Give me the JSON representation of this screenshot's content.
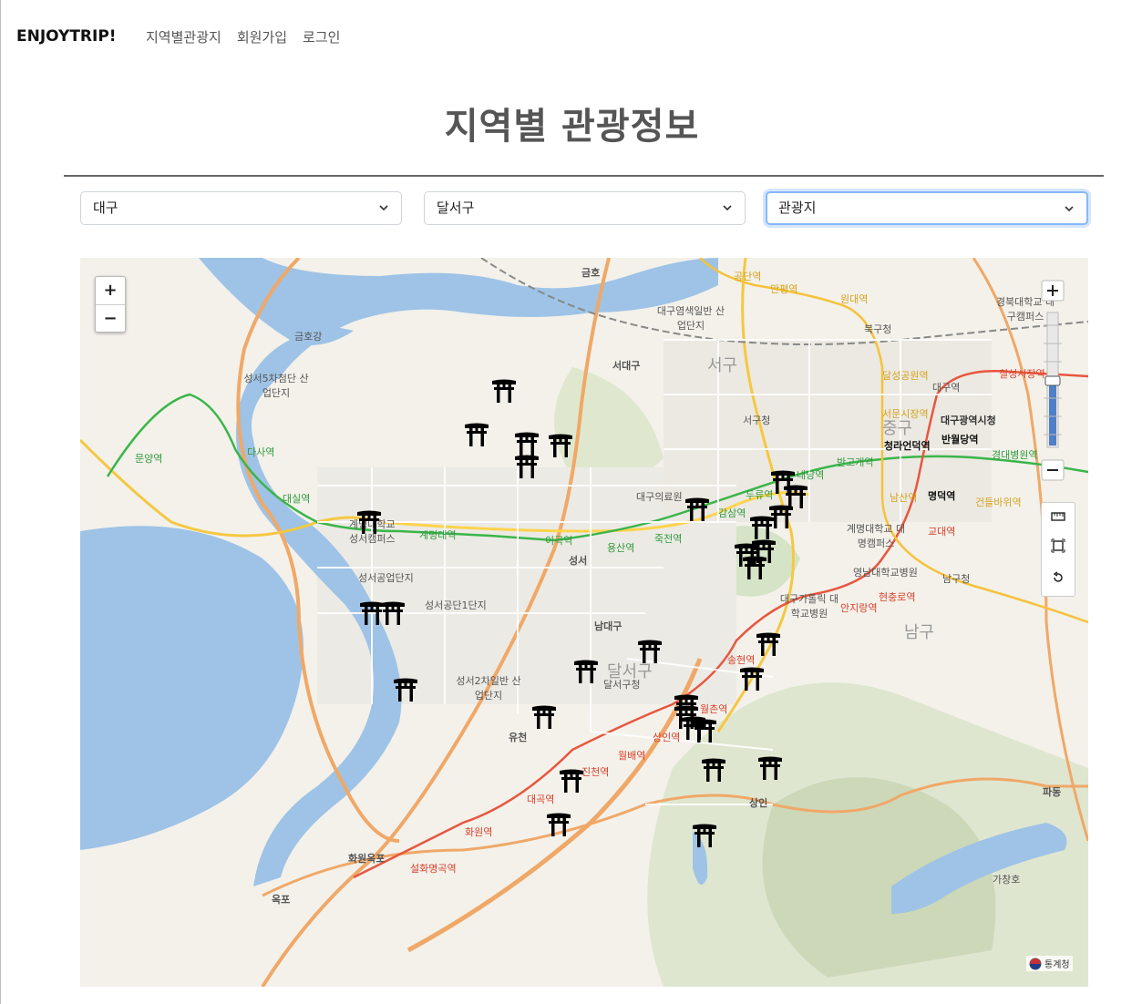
{
  "navbar": {
    "brand": "ENJOYTRIP!",
    "links": [
      "지역별관광지",
      "회원가입",
      "로그인"
    ]
  },
  "page": {
    "title": "지역별 관광정보"
  },
  "filters": {
    "region": "대구",
    "district": "달서구",
    "category": "관광지"
  },
  "map": {
    "zoom_in": "+",
    "zoom_out": "−",
    "copyright": "통계청",
    "area_labels": [
      "서구",
      "중구",
      "남구",
      "달서구"
    ],
    "place_labels": [
      "금호강",
      "성서5차첨단 산업단지",
      "대구의료원",
      "서구청",
      "대구광역시청",
      "계명대학교 성서캠퍼스",
      "성서공업단지",
      "성서공단1단지",
      "성서2차일반 산업단지",
      "달서구청",
      "계명대학교 대명캠퍼스",
      "영남대학교병원",
      "대구가톨릭 대학교병원",
      "남구청",
      "북구청",
      "대구염색일반 산업단지",
      "경북대학교 대구캠퍼스",
      "가창호",
      "대구역"
    ],
    "stations": [
      "문양역",
      "다사역",
      "대실역",
      "계명대역",
      "이곡역",
      "용산역",
      "죽전역",
      "감삼역",
      "두류역",
      "내당역",
      "반고개역",
      "청라언덕역",
      "반월당역",
      "경대병원역",
      "명덕역",
      "교대역",
      "남산역",
      "서문시장역",
      "달성공원역",
      "원대역",
      "만평역",
      "공단역",
      "칠성시장역",
      "송현역",
      "월촌역",
      "상인역",
      "월배역",
      "진천역",
      "대곡역",
      "화원역",
      "설화명곡역",
      "현충로역",
      "안지랑역",
      "건들바위역"
    ],
    "interchanges": [
      "서대구",
      "성서",
      "남대구",
      "유천",
      "화원옥포",
      "옥포",
      "상인",
      "파동",
      "금호"
    ],
    "markers_count": 31
  }
}
